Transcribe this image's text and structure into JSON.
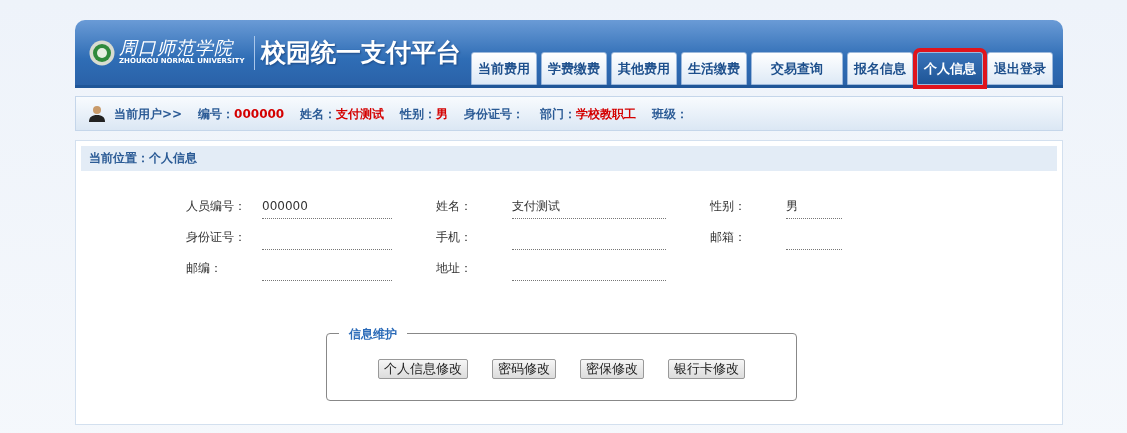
{
  "header": {
    "logo": {
      "name": "周口师范学院",
      "english": "ZHOUKOU NORMAL UNIVERSITY"
    },
    "title": "校园统一支付平台"
  },
  "tabs": [
    {
      "label": "当前费用",
      "selected": false,
      "highlighted": false
    },
    {
      "label": "学费缴费",
      "selected": false,
      "highlighted": false
    },
    {
      "label": "其他费用",
      "selected": false,
      "highlighted": false
    },
    {
      "label": "生活缴费",
      "selected": false,
      "highlighted": false
    },
    {
      "label": "交易查询",
      "selected": false,
      "highlighted": false
    },
    {
      "label": "报名信息",
      "selected": false,
      "highlighted": false
    },
    {
      "label": "个人信息",
      "selected": true,
      "highlighted": true
    },
    {
      "label": "退出登录",
      "selected": false,
      "highlighted": false
    }
  ],
  "user_bar": {
    "prefix": "当前用户>>",
    "fields": [
      {
        "label": "编号：",
        "value": "000000"
      },
      {
        "label": "姓名：",
        "value": "支付测试"
      },
      {
        "label": "性别：",
        "value": "男"
      },
      {
        "label": "身份证号："
      },
      {
        "label": "部门：",
        "value": "学校教职工"
      },
      {
        "label": "班级："
      }
    ]
  },
  "breadcrumb": "当前位置：个人信息",
  "info_fields": [
    {
      "label": "人员编号：",
      "value": "000000"
    },
    {
      "label": "姓名：",
      "value": "支付测试"
    },
    {
      "label": "性别：",
      "value": "男"
    },
    {
      "label": "身份证号："
    },
    {
      "label": "手机："
    },
    {
      "label": "邮箱："
    },
    {
      "label": "邮编："
    },
    {
      "label": "地址："
    }
  ],
  "maintenance": {
    "legend": "信息维护",
    "buttons": [
      "个人信息修改",
      "密码修改",
      "密保修改",
      "银行卡修改"
    ]
  }
}
